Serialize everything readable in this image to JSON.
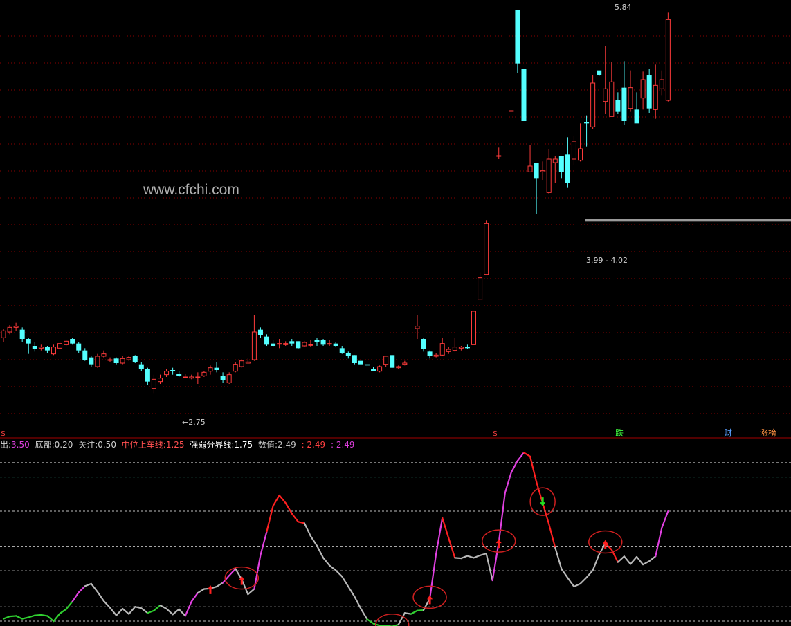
{
  "watermark": "www.cfchi.com",
  "colors": {
    "up": "#ff3b3b",
    "down": "#54ffff",
    "grid": "#8a0000",
    "separator": "#a40000",
    "line_gray": "#b8b8b8",
    "line_magenta": "#e040e0",
    "line_red": "#ff2020",
    "line_green": "#30d030",
    "marker_red": "#ff2020",
    "marker_green": "#20e020"
  },
  "legend": {
    "item1_label": "出:",
    "item1_value": "3.50",
    "item2_label": "底部:",
    "item2_value": "0.20",
    "item3_label": "关注:",
    "item3_value": "0.50",
    "item4_label": "中位上车线:",
    "item4_value": "1.25",
    "item5_label": "强弱分界线:",
    "item5_value": "1.75",
    "item6_label": "数值:",
    "item6_value": "2.49",
    "item7_value": ": 2.49",
    "item8_value": ": 2.49"
  },
  "annotations": {
    "high": "5.84",
    "low": "←2.75",
    "range": "3.99 - 4.02",
    "tag_dollar": "$",
    "tag_dollar2": "$",
    "tag_die": "跌",
    "tag_cai": "财",
    "tag_zhangbang": "涨榜"
  },
  "chart_data": [
    {
      "type": "candlestick",
      "title": "",
      "ylim": [
        2.3,
        5.9
      ],
      "candles": [
        [
          3.0,
          3.06,
          3.08,
          2.96
        ],
        [
          3.05,
          3.09,
          3.11,
          3.03
        ],
        [
          3.09,
          3.1,
          3.13,
          3.06
        ],
        [
          3.07,
          2.99,
          3.09,
          2.96
        ],
        [
          2.99,
          2.95,
          3.0,
          2.86
        ],
        [
          2.93,
          2.9,
          2.96,
          2.88
        ],
        [
          2.91,
          2.92,
          2.94,
          2.89
        ],
        [
          2.92,
          2.89,
          2.93,
          2.87
        ],
        [
          2.86,
          2.92,
          2.94,
          2.85
        ],
        [
          2.91,
          2.95,
          2.97,
          2.9
        ],
        [
          2.94,
          2.97,
          2.98,
          2.93
        ],
        [
          2.99,
          2.95,
          3.0,
          2.94
        ],
        [
          2.95,
          2.89,
          2.96,
          2.87
        ],
        [
          2.89,
          2.81,
          2.91,
          2.8
        ],
        [
          2.83,
          2.77,
          2.84,
          2.75
        ],
        [
          2.75,
          2.84,
          2.86,
          2.74
        ],
        [
          2.84,
          2.86,
          2.89,
          2.83
        ],
        [
          2.81,
          2.81,
          2.83,
          2.79
        ],
        [
          2.82,
          2.78,
          2.83,
          2.77
        ],
        [
          2.78,
          2.82,
          2.84,
          2.77
        ],
        [
          2.81,
          2.83,
          2.84,
          2.8
        ],
        [
          2.84,
          2.79,
          2.85,
          2.78
        ],
        [
          2.77,
          2.73,
          2.79,
          2.71
        ],
        [
          2.73,
          2.62,
          2.74,
          2.59
        ],
        [
          2.56,
          2.64,
          2.68,
          2.52
        ],
        [
          2.62,
          2.65,
          2.68,
          2.6
        ],
        [
          2.68,
          2.71,
          2.73,
          2.66
        ],
        [
          2.72,
          2.71,
          2.74,
          2.68
        ],
        [
          2.69,
          2.67,
          2.71,
          2.66
        ],
        [
          2.66,
          2.66,
          2.69,
          2.65
        ],
        [
          2.65,
          2.66,
          2.68,
          2.64
        ],
        [
          2.66,
          2.66,
          2.7,
          2.6
        ],
        [
          2.67,
          2.7,
          2.71,
          2.66
        ],
        [
          2.71,
          2.74,
          2.76,
          2.68
        ],
        [
          2.74,
          2.72,
          2.79,
          2.7
        ],
        [
          2.67,
          2.63,
          2.7,
          2.61
        ],
        [
          2.61,
          2.68,
          2.7,
          2.6
        ],
        [
          2.71,
          2.77,
          2.79,
          2.7
        ],
        [
          2.75,
          2.8,
          2.81,
          2.74
        ],
        [
          2.78,
          2.79,
          2.82,
          2.78
        ],
        [
          2.81,
          3.05,
          3.2,
          2.8
        ],
        [
          3.07,
          3.02,
          3.09,
          3.0
        ],
        [
          3.01,
          2.94,
          3.03,
          2.93
        ],
        [
          2.95,
          2.93,
          2.98,
          2.92
        ],
        [
          2.95,
          2.95,
          2.99,
          2.91
        ],
        [
          2.94,
          2.95,
          2.97,
          2.93
        ],
        [
          2.97,
          2.95,
          2.99,
          2.93
        ],
        [
          2.97,
          2.91,
          2.97,
          2.9
        ],
        [
          2.93,
          2.96,
          2.97,
          2.92
        ],
        [
          2.94,
          2.94,
          2.98,
          2.92
        ],
        [
          2.98,
          2.96,
          3.0,
          2.93
        ],
        [
          2.98,
          2.94,
          2.99,
          2.93
        ],
        [
          2.95,
          2.95,
          2.98,
          2.93
        ],
        [
          2.95,
          2.93,
          2.96,
          2.92
        ],
        [
          2.91,
          2.87,
          2.93,
          2.86
        ],
        [
          2.87,
          2.84,
          2.88,
          2.82
        ],
        [
          2.85,
          2.78,
          2.85,
          2.77
        ],
        [
          2.8,
          2.77,
          2.8,
          2.77
        ],
        [
          2.77,
          2.76,
          2.77,
          2.75
        ],
        [
          2.73,
          2.71,
          2.75,
          2.71
        ],
        [
          2.71,
          2.75,
          2.76,
          2.7
        ],
        [
          2.77,
          2.84,
          2.84,
          2.75
        ],
        [
          2.85,
          2.74,
          2.85,
          2.74
        ],
        [
          2.74,
          2.75,
          2.76,
          2.73
        ],
        [
          2.77,
          2.78,
          2.8,
          2.76
        ],
        null,
        [
          3.08,
          3.1,
          3.2,
          2.99
        ],
        [
          2.99,
          2.9,
          3.0,
          2.88
        ],
        [
          2.88,
          2.84,
          2.89,
          2.82
        ],
        [
          2.84,
          2.85,
          2.87,
          2.83
        ],
        [
          2.85,
          2.95,
          3.0,
          2.84
        ],
        [
          2.88,
          2.9,
          2.92,
          2.86
        ],
        [
          2.89,
          2.92,
          3.0,
          2.88
        ],
        [
          2.91,
          2.92,
          2.93,
          2.89
        ],
        [
          2.92,
          2.91,
          2.94,
          2.9
        ],
        [
          2.94,
          3.23,
          3.23,
          2.94
        ],
        [
          3.33,
          3.52,
          3.57,
          3.37
        ],
        [
          3.55,
          3.99,
          4.02,
          3.55
        ],
        null,
        [
          4.58,
          4.58,
          4.65,
          4.55
        ],
        null,
        [
          4.97,
          4.97,
          4.97,
          4.97
        ],
        [
          5.84,
          5.38,
          5.84,
          5.3
        ],
        [
          5.33,
          4.88,
          5.33,
          4.88
        ],
        [
          4.44,
          4.49,
          4.67,
          4.44
        ],
        [
          4.52,
          4.38,
          4.52,
          4.07
        ],
        [
          4.44,
          4.45,
          4.53,
          4.37
        ],
        [
          4.26,
          4.55,
          4.64,
          4.25
        ],
        [
          4.52,
          4.55,
          4.58,
          4.34
        ],
        [
          4.58,
          4.44,
          4.58,
          4.38
        ],
        [
          4.59,
          4.34,
          4.74,
          4.3
        ],
        [
          4.55,
          4.7,
          4.75,
          4.5
        ],
        [
          4.54,
          4.64,
          4.86,
          4.53
        ],
        [
          4.87,
          4.86,
          4.93,
          4.66
        ],
        [
          4.83,
          5.21,
          5.28,
          4.81
        ],
        [
          5.32,
          5.28,
          5.31,
          5.27
        ],
        [
          5.05,
          5.16,
          5.53,
          4.94
        ],
        [
          4.92,
          5.22,
          5.39,
          4.92
        ],
        [
          5.06,
          4.96,
          5.13,
          4.94
        ],
        [
          5.17,
          4.88,
          5.4,
          4.85
        ],
        [
          4.99,
          5.17,
          5.32,
          4.96
        ],
        [
          4.98,
          4.86,
          5.13,
          4.88
        ],
        [
          5.08,
          5.24,
          5.31,
          4.98
        ],
        [
          5.28,
          4.99,
          5.33,
          4.95
        ],
        [
          4.98,
          5.19,
          5.37,
          4.9
        ],
        [
          5.16,
          5.24,
          5.32,
          5.1
        ],
        [
          5.06,
          5.76,
          5.82,
          5.05
        ]
      ]
    },
    {
      "type": "line",
      "title": "",
      "ylim": [
        0.1,
        3.8
      ],
      "reference_levels": [
        3.5,
        3.2,
        2.49,
        1.75,
        1.25,
        0.5,
        0.2
      ],
      "values": [
        0.25,
        0.3,
        0.31,
        0.25,
        0.28,
        0.32,
        0.33,
        0.31,
        0.2,
        0.36,
        0.45,
        0.61,
        0.8,
        0.93,
        0.98,
        0.81,
        0.62,
        0.48,
        0.32,
        0.46,
        0.35,
        0.5,
        0.47,
        0.37,
        0.42,
        0.53,
        0.46,
        0.34,
        0.45,
        0.31,
        0.61,
        0.79,
        0.87,
        0.88,
        0.92,
        1.0,
        1.15,
        1.29,
        1.07,
        0.76,
        0.87,
        1.58,
        2.07,
        2.6,
        2.82,
        2.66,
        2.44,
        2.27,
        2.24,
        1.97,
        1.77,
        1.52,
        1.36,
        1.26,
        1.13,
        0.92,
        0.71,
        0.46,
        0.24,
        0.15,
        0.11,
        0.11,
        0.09,
        0.13,
        0.37,
        0.35,
        0.42,
        0.43,
        0.67,
        1.6,
        2.35,
        1.93,
        1.52,
        1.51,
        1.56,
        1.52,
        1.57,
        1.61,
        1.05,
        1.84,
        2.87,
        3.3,
        3.54,
        3.71,
        3.63,
        3.1,
        2.66,
        2.22,
        1.73,
        1.29,
        1.1,
        0.92,
        0.98,
        1.11,
        1.26,
        1.59,
        1.82,
        1.69,
        1.43,
        1.55,
        1.39,
        1.54,
        1.38,
        1.45,
        1.55,
        2.14,
        2.49
      ],
      "segment_colors": [
        "green",
        "green",
        "green",
        "green",
        "green",
        "green",
        "green",
        "green",
        "green",
        "green",
        "green",
        "magenta",
        "magenta",
        "gray",
        "gray",
        "gray",
        "gray",
        "gray",
        "gray",
        "gray",
        "gray",
        "gray",
        "gray",
        "green",
        "green",
        "gray",
        "gray",
        "gray",
        "gray",
        "magenta",
        "magenta",
        "gray",
        "gray",
        "gray",
        "gray",
        "magenta",
        "magenta",
        "gray",
        "gray",
        "gray",
        "magenta",
        "magenta",
        "red",
        "red",
        "red",
        "red",
        "red",
        "red",
        "gray",
        "gray",
        "gray",
        "gray",
        "gray",
        "gray",
        "gray",
        "gray",
        "gray",
        "gray",
        "green",
        "green",
        "green",
        "green",
        "green",
        "gray",
        "gray",
        "green",
        "green",
        "gray",
        "magenta",
        "magenta",
        "red",
        "red",
        "gray",
        "gray",
        "gray",
        "gray",
        "gray",
        "gray",
        "magenta",
        "magenta",
        "magenta",
        "magenta",
        "magenta",
        "red",
        "red",
        "red",
        "red",
        "red",
        "gray",
        "gray",
        "gray",
        "gray",
        "gray",
        "gray",
        "gray",
        "gray",
        "red",
        "red",
        "gray",
        "gray",
        "gray",
        "gray",
        "gray",
        "gray",
        "magenta",
        "magenta"
      ],
      "up_arrows_at": [
        33,
        38,
        68,
        79,
        96
      ],
      "down_arrows_at": [
        86
      ],
      "circled_at": [
        38,
        62,
        68,
        79,
        86,
        96
      ]
    }
  ]
}
